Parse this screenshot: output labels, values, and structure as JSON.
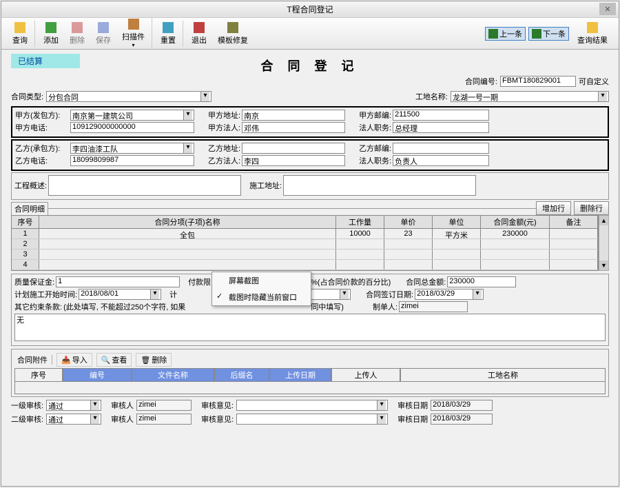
{
  "window": {
    "title": "T程合同登记"
  },
  "toolbar": {
    "query": "查询",
    "add": "添加",
    "delete": "删除",
    "save": "保存",
    "scan": "扫描件",
    "reset": "重置",
    "exit": "退出",
    "template": "模板修复",
    "prev": "上一条",
    "next": "下一条",
    "result": "查询结果"
  },
  "status_badge": "已结算",
  "page_title": "合 同 登 记",
  "header": {
    "contract_no_label": "合同编号:",
    "contract_no": "FBMT180829001",
    "custom_label": "可自定义"
  },
  "top": {
    "contract_type_label": "合同类型:",
    "contract_type": "分包合同",
    "site_name_label": "工地名称:",
    "site_name": "龙湖一号一期"
  },
  "partyA": {
    "name_label": "甲方(发包方):",
    "name": "南京第一建筑公司",
    "addr_label": "甲方地址:",
    "addr": "南京",
    "post_label": "甲方邮编:",
    "post": "211500",
    "phone_label": "甲方电话:",
    "phone": "109129000000000",
    "legal_label": "甲方法人:",
    "legal": "邓伟",
    "duty_label": "法人职务:",
    "duty": "总经理"
  },
  "partyB": {
    "name_label": "乙方(承包方):",
    "name": "李四油漆工队",
    "addr_label": "乙方地址:",
    "addr": "",
    "post_label": "乙方邮编:",
    "post": "",
    "phone_label": "乙方电话:",
    "phone": "18099809987",
    "legal_label": "乙方法人:",
    "legal": "李四",
    "duty_label": "法人职务:",
    "duty": "负责人"
  },
  "desc": {
    "project_label": "工程概述:",
    "project": "",
    "construct_label": "施工地址:",
    "construct": ""
  },
  "detail": {
    "section": "合同明细",
    "add_row": "增加行",
    "del_row": "删除行",
    "cols": {
      "seq": "序号",
      "name": "合同分项(子项)名称",
      "qty": "工作量",
      "price": "单价",
      "unit": "单位",
      "amount": "合同金额(元)",
      "remark": "备注"
    },
    "rows": [
      {
        "seq": "1",
        "name": "全包",
        "qty": "10000",
        "price": "23",
        "unit": "平方米",
        "amount": "230000",
        "remark": ""
      },
      {
        "seq": "2"
      },
      {
        "seq": "3"
      },
      {
        "seq": "4"
      }
    ]
  },
  "mid": {
    "quality_label": "质量保证金:",
    "quality": "1",
    "pay_limit_label": "付款限:",
    "pct_label": "%(占合同价款的百分比)",
    "total_label": "合同总金额:",
    "total": "230000",
    "plan_start_label": "计划施工开始时间:",
    "plan_start": "2018/08/01",
    "sign_date_label": "合同签订日期:",
    "sign_date": "2018/03/29",
    "other_label": "其它约束条款:",
    "other_hint": "(此处填写, 不能超过250个字符, 如果",
    "other_hint2": "同中填写)",
    "maker_label": "制单人:",
    "maker": "zimei",
    "other_value": "无"
  },
  "context_menu": {
    "item1": "屏幕截图",
    "item2": "截图时隐藏当前窗口"
  },
  "attach": {
    "section": "合同附件",
    "import": "导入",
    "view": "查看",
    "delete": "删除",
    "cols": {
      "seq": "序号",
      "no": "编号",
      "filename": "文件名称",
      "ext": "后缀名",
      "upload_date": "上传日期",
      "uploader": "上传人",
      "site": "工地名称"
    }
  },
  "audit1": {
    "level_label": "一级审核:",
    "level": "通过",
    "person_label": "审核人",
    "person": "zimei",
    "opinion_label": "审核意见:",
    "opinion": "",
    "date_label": "审核日期",
    "date": "2018/03/29"
  },
  "audit2": {
    "level_label": "二级审核:",
    "level": "通过",
    "person_label": "审核人",
    "person": "zimei",
    "opinion_label": "审核意见:",
    "opinion": "",
    "date_label": "审核日期",
    "date": "2018/03/29"
  }
}
